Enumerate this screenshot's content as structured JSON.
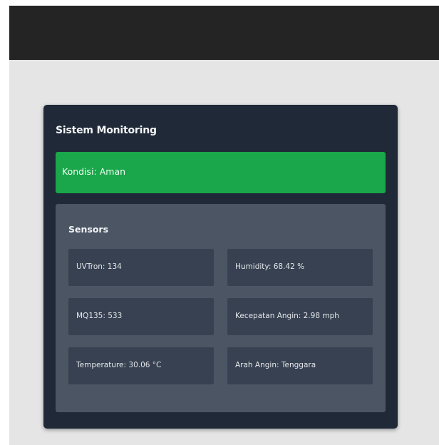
{
  "card": {
    "title": "Sistem Monitoring"
  },
  "status": {
    "text": "Kondisi: Aman",
    "color": "#1aa64a"
  },
  "sensors": {
    "title": "Sensors",
    "items": [
      {
        "label": "UVTron: 134"
      },
      {
        "label": "Humidity: 68.42 %"
      },
      {
        "label": "MQ135: 533"
      },
      {
        "label": "Kecepatan Angin: 2.98 mph"
      },
      {
        "label": "Temperature: 30.06 °C"
      },
      {
        "label": "Arah Angin: Tenggara"
      }
    ]
  }
}
